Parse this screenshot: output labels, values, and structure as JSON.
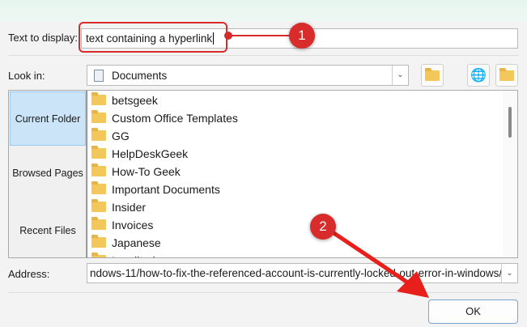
{
  "dialog": {
    "text_to_display_label": "Text to display:",
    "text_to_display_value": "text containing a hyperlink",
    "look_in_label": "Look in:",
    "look_in_value": "Documents",
    "nav": [
      {
        "label": "Current Folder",
        "selected": true
      },
      {
        "label": "Browsed Pages",
        "selected": false
      },
      {
        "label": "Recent Files",
        "selected": false
      }
    ],
    "files": [
      "betsgeek",
      "Custom Office Templates",
      "GG",
      "HelpDeskGeek",
      "How-To Geek",
      "Important Documents",
      "Insider",
      "Invoices",
      "Japanese",
      "Lenditreica"
    ],
    "address_label": "Address:",
    "address_value": "ndows-11/how-to-fix-the-referenced-account-is-currently-locked-out-error-in-windows/",
    "ok_label": "OK"
  },
  "annotations": {
    "step1": "1",
    "step2": "2",
    "color": "#d82b2b"
  },
  "colors": {
    "selected_nav": "#cce4f7",
    "accent": "#0067c0"
  }
}
